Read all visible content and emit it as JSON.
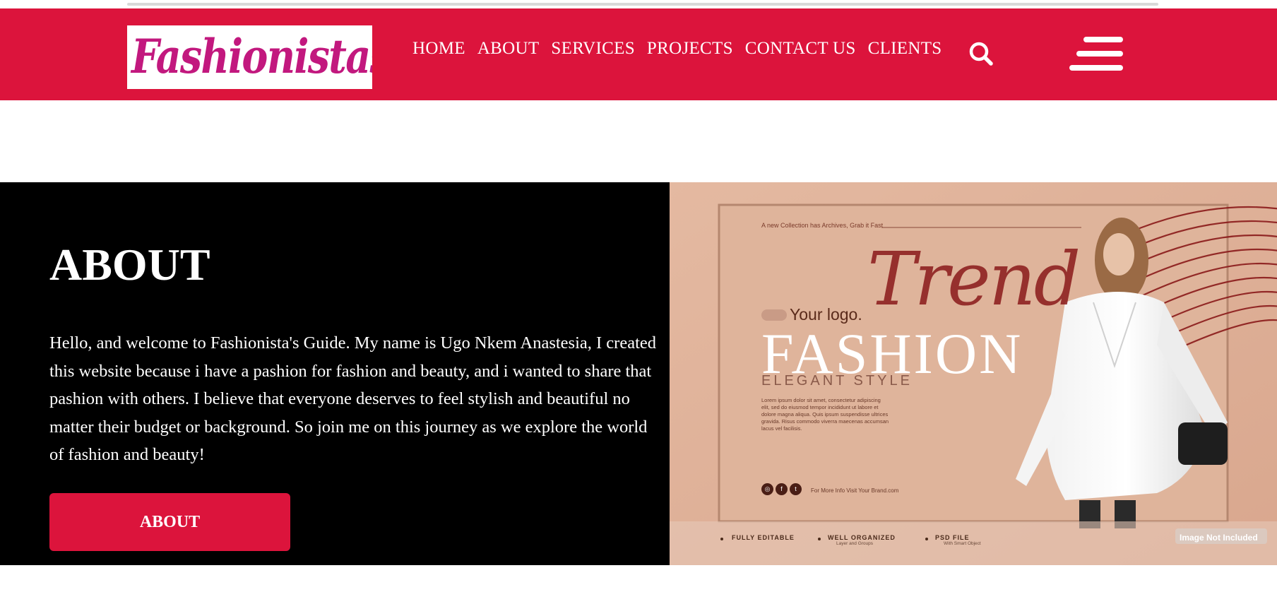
{
  "brand": {
    "logo_text": "Fashionistas",
    "primary_color": "#dc143c",
    "logo_color": "#c2187e"
  },
  "nav": {
    "items": [
      "HOME",
      "ABOUT",
      "SERVICES",
      "PROJECTS",
      "CONTACT US",
      "CLIENTS"
    ],
    "search_icon": "search-icon",
    "menu_icon": "hamburger-menu-icon"
  },
  "about": {
    "title": "ABOUT",
    "body": "Hello, and welcome to Fashionista's Guide. My name is Ugo Nkem Anastesia, I created this website because i have a pashion for fashion and beauty, and i wanted to share that pashion with others. I believe that everyone deserves to feel stylish and beautiful no matter their budget or background. So join me on this journey as we explore the world of fashion and beauty!",
    "button_label": "ABOUT",
    "background_color": "#000000"
  },
  "promo": {
    "tagline": "A new Collection has Archives, Grab it Fast",
    "your_logo": "Your logo.",
    "script_word": "Trend",
    "headline": "FASHION",
    "subheadline": "ELEGANT STYLE",
    "lorem": "Lorem ipsum dolor sit amet, consectetur adipiscing elit, sed do eiusmod tempor incididunt ut labore et dolore magna aliqua. Quis ipsum suspendisse ultrices gravida. Risus commodo viverra maecenas accumsan lacus vel facilisis.",
    "more_info": "For More Info Visit Your Brand.com",
    "features": [
      {
        "title": "FULLY EDITABLE",
        "sub": ""
      },
      {
        "title": "WELL ORGANIZED",
        "sub": "Layer and Groups"
      },
      {
        "title": "PSD FILE",
        "sub": "With Smart Object"
      }
    ],
    "image_note": "Image Not Included",
    "background_color": "#e1b39a"
  }
}
